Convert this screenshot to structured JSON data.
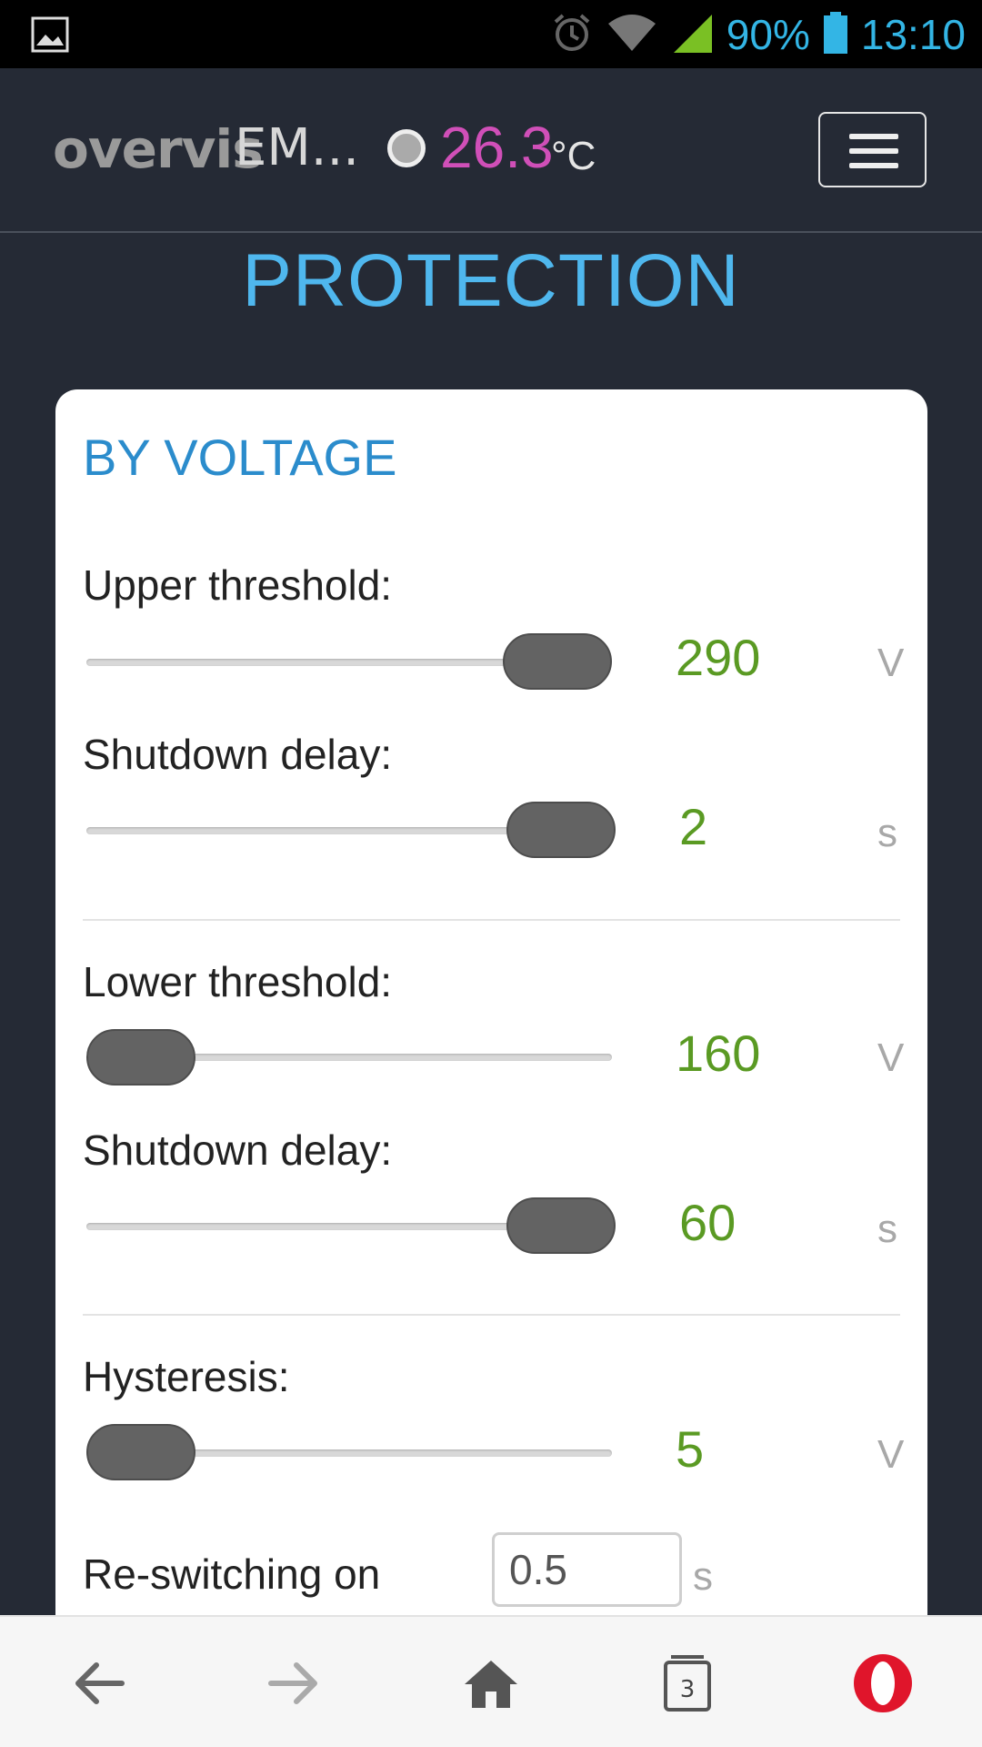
{
  "statusbar": {
    "battery_percent": "90%",
    "time": "13:10",
    "icons": [
      "image-icon",
      "alarm-icon",
      "wifi-icon",
      "signal-icon",
      "battery-icon"
    ]
  },
  "header": {
    "brand": "overvis",
    "model": "EM...",
    "temperature": "26.3",
    "temperature_unit": "°C",
    "colors": {
      "temperature": "#d04fb8",
      "background": "#252a35"
    }
  },
  "page": {
    "title": "PROTECTION"
  },
  "card": {
    "title": "BY VOLTAGE",
    "rows": [
      {
        "label": "Upper threshold:",
        "value": "290",
        "unit": "V",
        "level": 1.0
      },
      {
        "label": "Shutdown delay:",
        "value": "2",
        "unit": "s",
        "level": 1.0
      },
      {
        "label": "Lower threshold:",
        "value": "160",
        "unit": "V",
        "level": 0.0
      },
      {
        "label": "Shutdown delay:",
        "value": "60",
        "unit": "s",
        "level": 1.0
      },
      {
        "label": "Hysteresis:",
        "value": "5",
        "unit": "V",
        "level": 0.0
      }
    ],
    "reswitch": {
      "label": "Re-switching on delay:",
      "value": "0.5",
      "unit": "s"
    },
    "colors": {
      "value": "#5a9a23",
      "title": "#2b8ccc"
    }
  },
  "bottombar": {
    "tabs_count": "3",
    "icons": [
      "back-arrow-icon",
      "forward-arrow-icon",
      "home-icon",
      "tabs-icon",
      "opera-icon"
    ]
  }
}
